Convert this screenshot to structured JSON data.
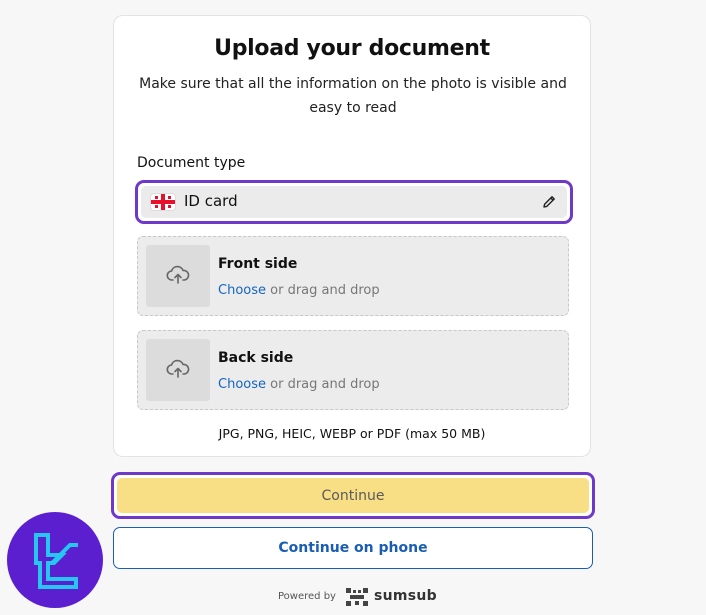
{
  "upload": {
    "title": "Upload your document",
    "subtitle": "Make sure that all the information on the photo is visible and easy to read",
    "document_type_label": "Document type",
    "document_type_value": "ID card",
    "document_flag": "georgia-flag",
    "front": {
      "title": "Front side",
      "choose": "Choose",
      "hint": " or drag and drop"
    },
    "back": {
      "title": "Back side",
      "choose": "Choose",
      "hint": " or drag and drop"
    },
    "formats": "JPG, PNG, HEIC, WEBP or PDF (max 50 MB)"
  },
  "actions": {
    "continue_label": "Continue",
    "phone_label": "Continue on phone"
  },
  "footer": {
    "powered_by": "Powered by",
    "brand": "sumsub"
  },
  "colors": {
    "highlight": "#6e39c9",
    "continue_bg": "#f8de84",
    "link": "#1565c0",
    "phone_border": "#1a5db4",
    "corner_logo_bg": "#5b1fd0",
    "corner_logo_accent": "#27c6f0"
  }
}
